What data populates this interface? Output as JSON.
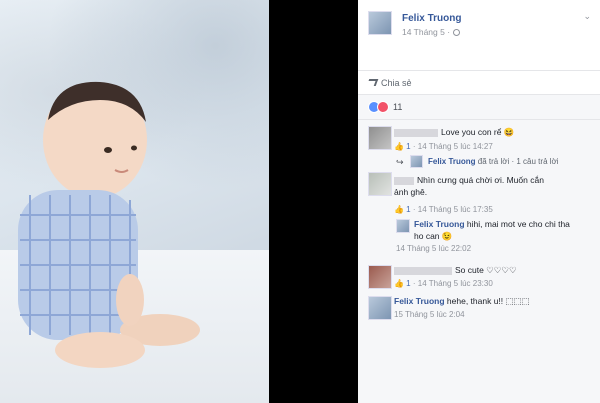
{
  "post": {
    "author": "Felix Truong",
    "date": "14 Tháng 5 ·",
    "share_label": "Chia sẻ",
    "reaction_count": "11"
  },
  "comments": [
    {
      "text": "Love you con rể 😆",
      "meta_like": "👍 1",
      "meta_time": "· 14 Tháng 5 lúc 14:27"
    },
    {
      "reply_author": "Felix Truong",
      "reply_text": "đã trả lời · 1 câu trả lời"
    },
    {
      "text_line1": "Nhìn cưng quá chời ơi. Muốn cắn",
      "text_line2": "ảnh ghê.",
      "meta_like": "👍 1",
      "meta_time": "· 14 Tháng 5 lúc 17:35"
    },
    {
      "reply_author": "Felix Truong",
      "reply_text_line1": "hihi, mai mot ve cho chi tha",
      "reply_text_line2": "ho can 😉",
      "reply_time": "14 Tháng 5 lúc 22:02"
    },
    {
      "text": "So cute ♡♡♡♡",
      "meta_like": "👍 1",
      "meta_time": "· 14 Tháng 5 lúc 23:30"
    },
    {
      "author": "Felix Truong",
      "text": "hehe, thank u!! ⬚⬚⬚",
      "meta_time": "15 Tháng 5 lúc 2:04"
    }
  ]
}
